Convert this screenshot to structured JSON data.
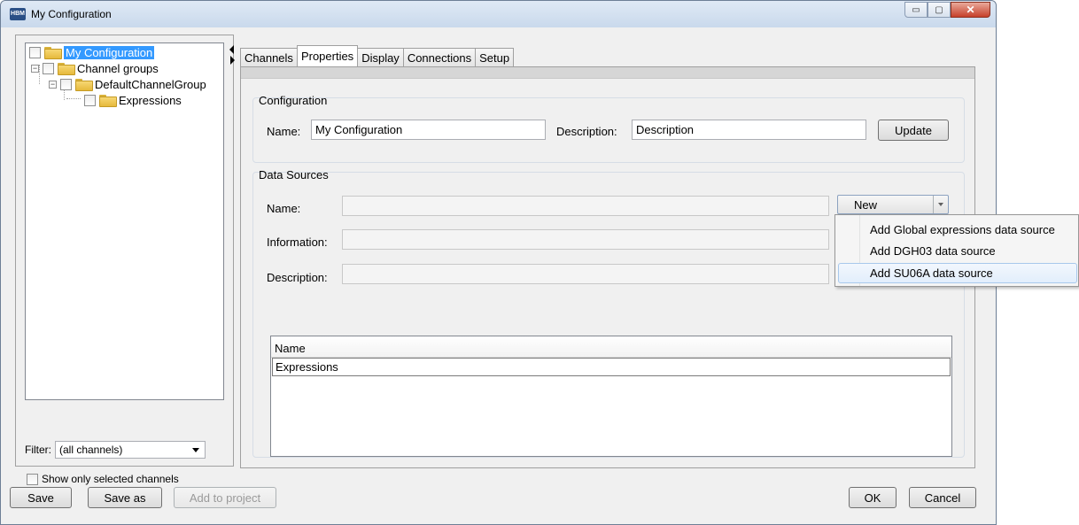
{
  "window": {
    "title": "My Configuration",
    "app_icon_text": "HBM",
    "controls": {
      "minimize": "▭",
      "maximize": "▢",
      "close": "✕"
    }
  },
  "tree": {
    "root": "My Configuration",
    "channel_groups": "Channel groups",
    "default_group": "DefaultChannelGroup",
    "expressions": "Expressions"
  },
  "filter": {
    "label": "Filter:",
    "value": "(all channels)"
  },
  "show_only_selected": "Show only selected channels",
  "tabs": [
    "Channels",
    "Properties",
    "Display",
    "Connections",
    "Setup"
  ],
  "active_tab": "Properties",
  "configuration": {
    "title": "Configuration",
    "name_label": "Name:",
    "name_value": "My Configuration",
    "description_label": "Description:",
    "description_value": "Description",
    "update_button": "Update"
  },
  "data_sources": {
    "title": "Data Sources",
    "name_label": "Name:",
    "information_label": "Information:",
    "description_label": "Description:",
    "new_button": "New",
    "table_header": "Name",
    "rows": [
      "Expressions"
    ]
  },
  "menu": {
    "items": [
      "Add Global expressions data source",
      "Add DGH03 data source",
      "Add SU06A data source"
    ],
    "hover_index": 2
  },
  "buttons": {
    "save": "Save",
    "save_as": "Save as",
    "add_to_project": "Add to project",
    "ok": "OK",
    "cancel": "Cancel"
  },
  "colors": {
    "selection": "#3399ff",
    "window_bg": "#f0f0f0"
  }
}
